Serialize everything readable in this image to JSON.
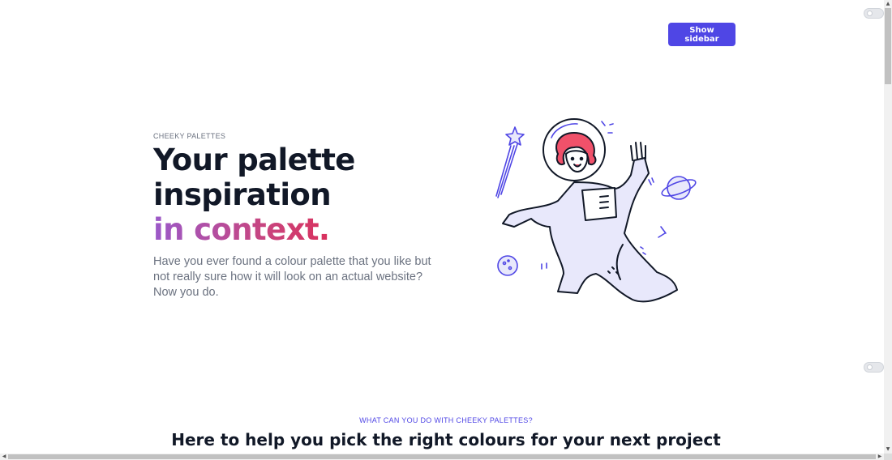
{
  "header": {
    "show_sidebar_label": "Show sidebar"
  },
  "hero": {
    "eyebrow": "CHEEKY PALETTES",
    "headline_line1": "Your palette",
    "headline_line2": "inspiration",
    "headline_line3": "in context.",
    "lead": "Have you ever found a colour palette that you like but not really sure how it will look on an actual website? Now you do.",
    "illustration": "astronaut-illustration"
  },
  "features": {
    "eyebrow": "WHAT CAN YOU DO WITH CHEEKY PALETTES?",
    "title": "Here to help you pick the right colours for your next project"
  },
  "colors": {
    "accent": "#4f46e5",
    "heading": "#111827",
    "body": "#6b7280",
    "gradient_start": "#9b59c9",
    "gradient_end": "#e0294f",
    "hair": "#f0516a",
    "suit_fill": "#e8e8fb"
  }
}
